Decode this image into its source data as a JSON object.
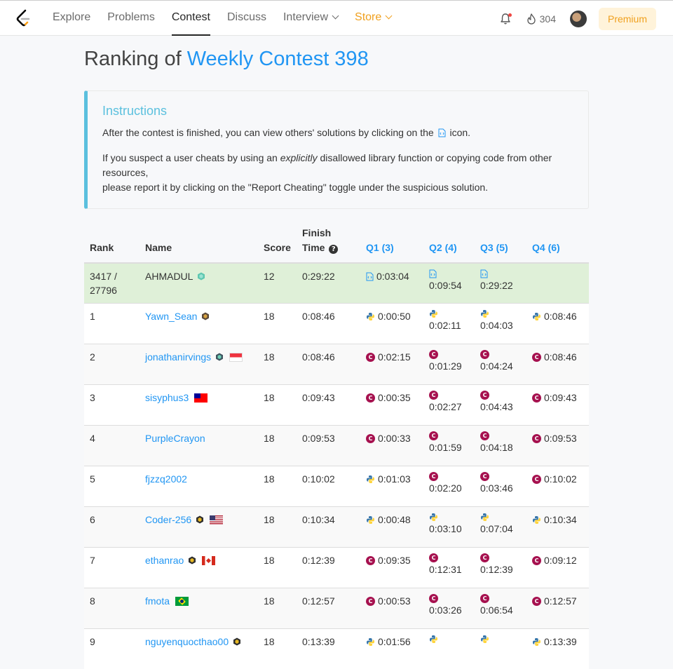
{
  "nav": {
    "links": [
      {
        "label": "Explore"
      },
      {
        "label": "Problems"
      },
      {
        "label": "Contest"
      },
      {
        "label": "Discuss"
      },
      {
        "label": "Interview"
      },
      {
        "label": "Store"
      }
    ],
    "streak_count": "304",
    "premium_label": "Premium",
    "accent_store": "#f0a01e"
  },
  "page": {
    "title_prefix": "Ranking of ",
    "contest_name": "Weekly Contest 398"
  },
  "instructions": {
    "title": "Instructions",
    "p1_before": "After the contest is finished, you can view others' solutions by clicking on the",
    "p1_after": "icon.",
    "p2_before": "If you suspect a user cheats by using an ",
    "p2_em": "explicitly",
    "p2_after": " disallowed library function or copying code from other resources,",
    "p2_line2": "please report it by clicking on the \"Report Cheating\" toggle under the suspicious solution."
  },
  "table": {
    "headers": {
      "rank": "Rank",
      "name": "Name",
      "score": "Score",
      "finish_line1": "Finish",
      "finish_line2": "Time",
      "q1": "Q1 (3)",
      "q2": "Q2 (4)",
      "q3": "Q3 (5)",
      "q4": "Q4 (6)"
    },
    "me": {
      "rank_line1": "3417 /",
      "rank_line2": "27796",
      "name": "AHMADUL",
      "score": "12",
      "finish": "0:29:22",
      "q1": "0:03:04",
      "q2": "0:09:54",
      "q3": "0:29:22",
      "q4": ""
    },
    "rows": [
      {
        "rank": "1",
        "name": "Yawn_Sean",
        "score": "18",
        "finish": "0:08:46",
        "q1": "0:00:50",
        "q2": "0:02:11",
        "q3": "0:04:03",
        "q4": "0:08:46",
        "lang": "python"
      },
      {
        "rank": "2",
        "name": "jonathanirvings",
        "score": "18",
        "finish": "0:08:46",
        "q1": "0:02:15",
        "q2": "0:01:29",
        "q3": "0:04:24",
        "q4": "0:08:46",
        "lang": "cpp"
      },
      {
        "rank": "3",
        "name": "sisyphus3",
        "score": "18",
        "finish": "0:09:43",
        "q1": "0:00:35",
        "q2": "0:02:27",
        "q3": "0:04:43",
        "q4": "0:09:43",
        "lang": "cpp"
      },
      {
        "rank": "4",
        "name": "PurpleCrayon",
        "score": "18",
        "finish": "0:09:53",
        "q1": "0:00:33",
        "q2": "0:01:59",
        "q3": "0:04:18",
        "q4": "0:09:53",
        "lang": "cpp"
      },
      {
        "rank": "5",
        "name": "fjzzq2002",
        "score": "18",
        "finish": "0:10:02",
        "q1": "0:01:03",
        "q2": "0:02:20",
        "q3": "0:03:46",
        "q4": "0:10:02",
        "lang": "mixed"
      },
      {
        "rank": "6",
        "name": "Coder-256",
        "score": "18",
        "finish": "0:10:34",
        "q1": "0:00:48",
        "q2": "0:03:10",
        "q3": "0:07:04",
        "q4": "0:10:34",
        "lang": "python"
      },
      {
        "rank": "7",
        "name": "ethanrao",
        "score": "18",
        "finish": "0:12:39",
        "q1": "0:09:35",
        "q2": "0:12:31",
        "q3": "0:12:39",
        "q4": "0:09:12",
        "lang": "cpp"
      },
      {
        "rank": "8",
        "name": "fmota",
        "score": "18",
        "finish": "0:12:57",
        "q1": "0:00:53",
        "q2": "0:03:26",
        "q3": "0:06:54",
        "q4": "0:12:57",
        "lang": "cpp"
      },
      {
        "rank": "9",
        "name": "nguyenquocthao00",
        "score": "18",
        "finish": "0:13:39",
        "q1": "0:01:56",
        "q2": "",
        "q3": "",
        "q4": "0:13:39",
        "lang": "python"
      }
    ]
  }
}
